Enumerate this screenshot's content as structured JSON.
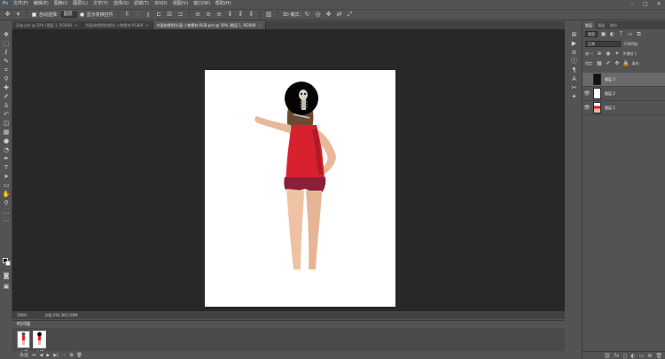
{
  "app": {
    "logo": "Ps"
  },
  "menu": [
    "文件(F)",
    "编辑(E)",
    "图像(I)",
    "图层(L)",
    "文字(Y)",
    "选择(S)",
    "滤镜(T)",
    "3D(D)",
    "视图(V)",
    "窗口(W)",
    "帮助(H)"
  ],
  "window_controls": [
    "–",
    "□",
    "✕"
  ],
  "options_bar": {
    "auto_select_label": "自动选择:",
    "auto_select_value": "图层",
    "transform_label": "显示变换控件"
  },
  "tabs": [
    {
      "label": "开始.psd @ 50% (图层 1, RGB/8)",
      "active": false
    },
    {
      "label": "外面/刻透明的透光-人物素材-RGB/8",
      "active": false
    },
    {
      "label": "外面刻透明/头盔-人物素材-RGB.psd @ 50% (图层 1, RGB/8)",
      "active": true
    }
  ],
  "status": {
    "zoom": "100%",
    "doc": "文档:293.3K/2.00M"
  },
  "timeline": {
    "title": "时间轴",
    "frames": [
      {
        "label": "0.2秒"
      },
      {
        "label": "0.2秒"
      }
    ],
    "loop": "永远"
  },
  "right_panel": {
    "tabs": [
      "图层",
      "通道",
      "路径"
    ],
    "kind_filter": "类型",
    "blend_mode": "正常",
    "opacity_label": "不透明度:",
    "lock_label": "锁定:",
    "fill_label": "填充:",
    "unify_label": "传播帧 1",
    "layers": [
      {
        "name": "图层 3",
        "selected": true,
        "visible": true
      },
      {
        "name": "图层 2",
        "selected": false,
        "visible": true
      },
      {
        "name": "图层 1",
        "selected": false,
        "visible": true
      }
    ]
  },
  "colors": {
    "accent": "#7ab4e8",
    "canvas_bg": "#282828",
    "ui_bg": "#535353"
  }
}
